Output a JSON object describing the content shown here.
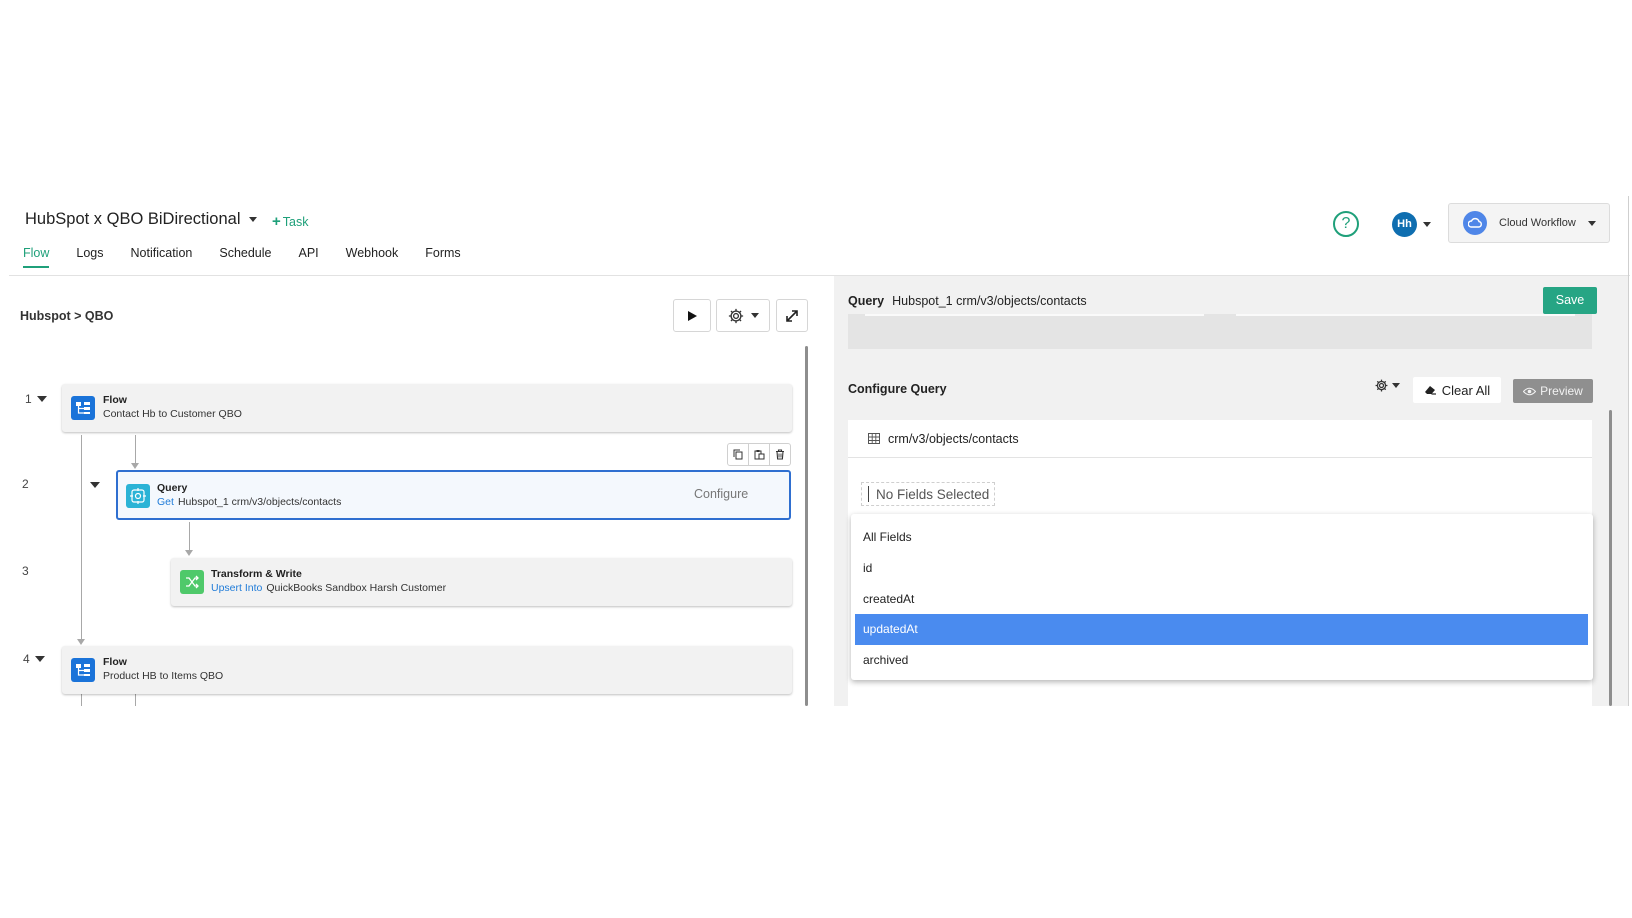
{
  "header": {
    "title": "HubSpot x QBO BiDirectional",
    "task_label": "Task",
    "tabs": [
      {
        "label": "Flow"
      },
      {
        "label": "Logs"
      },
      {
        "label": "Notification"
      },
      {
        "label": "Schedule"
      },
      {
        "label": "API"
      },
      {
        "label": "Webhook"
      },
      {
        "label": "Forms"
      }
    ],
    "avatar_initials": "Hh",
    "workspace_label": "Cloud Workflow"
  },
  "canvas": {
    "breadcrumb": "Hubspot > QBO",
    "steps": [
      {
        "number": "1",
        "title": "Flow",
        "subtitle": "Contact Hb to Customer QBO"
      },
      {
        "number": "2",
        "title": "Query",
        "verb": "Get",
        "subtitle": "Hubspot_1  crm/v3/objects/contacts",
        "action": "Configure"
      },
      {
        "number": "3",
        "title": "Transform & Write",
        "verb": "Upsert Into",
        "subtitle": "QuickBooks Sandbox Harsh  Customer"
      },
      {
        "number": "4",
        "title": "Flow",
        "subtitle": "Product HB to Items QBO"
      }
    ]
  },
  "panel": {
    "type_label": "Query",
    "path": "Hubspot_1 crm/v3/objects/contacts",
    "save_label": "Save",
    "section_title": "Configure Query",
    "clear_label": "Clear All",
    "preview_label": "Preview",
    "endpoint": "crm/v3/objects/contacts",
    "fields_placeholder": "No Fields Selected",
    "field_options": [
      {
        "label": "All Fields"
      },
      {
        "label": "id"
      },
      {
        "label": "createdAt"
      },
      {
        "label": "updatedAt"
      },
      {
        "label": "archived"
      }
    ],
    "selected_option": "updatedAt"
  },
  "colors": {
    "brand_green": "#1fa07a",
    "save_green": "#26a584",
    "selection_blue": "#4a8bef",
    "link_blue": "#1f7bd8",
    "flow_icon_blue": "#1a73d9",
    "query_icon_cyan": "#2bb3d6",
    "transform_icon_green": "#4fc96a"
  }
}
